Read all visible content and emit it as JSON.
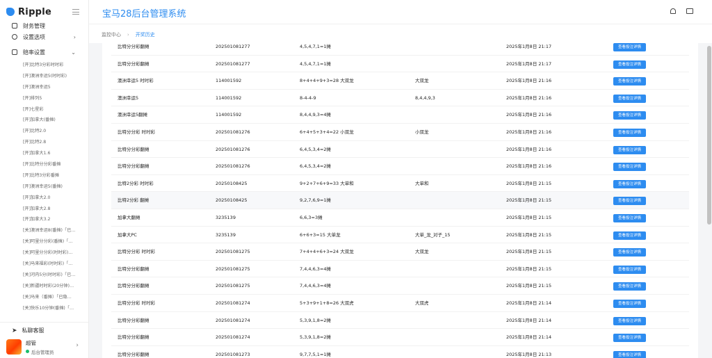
{
  "app": {
    "logo": "Ripple",
    "title": "宝马28后台管理系统"
  },
  "sidebar": {
    "partial_item": "财务管理",
    "settings": "设置选项",
    "lottery": "赔率设置",
    "items": [
      "[开]比特3分彩时时彩",
      "[开]澳洲幸运5(时时彩)",
      "[开]澳洲幸运5",
      "[开]排列5",
      "[开]七星彩",
      "[开]加拿大(番摊)",
      "[开]比特2.0",
      "[开]比特2.8",
      "[开]加拿大1.6",
      "[开]比特分分彩番摊",
      "[开]比特3分彩番摊",
      "[开]澳洲幸运5(番摊)",
      "[开]加拿大2.0",
      "[开]加拿大2.8",
      "[开]加拿大3.2",
      "[关]澳洲幸运8(番摊)「已…",
      "[关]阿里分分彩(番摊)「…",
      "[关]阿里分分彩(时时彩)…",
      "[关]马来福彩(时时彩)「…",
      "[关]河内5分(时时彩)「已…",
      "[关]新疆时时彩(20分钟)…",
      "[关]马来（番摊）「已隐…",
      "[关]快乐10分钟(番摊)「…"
    ],
    "service": "私聊客服",
    "user": {
      "name": "超管",
      "role": "后台管理员"
    }
  },
  "breadcrumb": {
    "home": "监控中心",
    "current": "开奖历史"
  },
  "table": {
    "button_label": "查看投注详情",
    "rows": [
      {
        "game": "比特分分彩翻摊",
        "issue": "202501081277",
        "result": "4,5,4,7,1=1摊",
        "extra": "",
        "time": "2025年1月8日 21:17"
      },
      {
        "game": "比特分分彩翻摊",
        "issue": "202501081277",
        "result": "4,5,4,7,1=1摊",
        "extra": "",
        "time": "2025年1月8日 21:17"
      },
      {
        "game": "澳洲幸运5 时时彩",
        "issue": "114001592",
        "result": "8+4+4+9+3=28 大双龙",
        "extra": "大双龙",
        "time": "2025年1月8日 21:16"
      },
      {
        "game": "澳洲幸运5",
        "issue": "114001592",
        "result": "8-4-4-9",
        "extra": "8,4,4,9,3",
        "time": "2025年1月8日 21:16"
      },
      {
        "game": "澳洲幸运5翻摊",
        "issue": "114001592",
        "result": "8,4,4,9,3=4摊",
        "extra": "",
        "time": "2025年1月8日 21:16"
      },
      {
        "game": "比特分分彩 时时彩",
        "issue": "202501081276",
        "result": "6+4+5+3+4=22 小双龙",
        "extra": "小双龙",
        "time": "2025年1月8日 21:16"
      },
      {
        "game": "比特分分彩翻摊",
        "issue": "202501081276",
        "result": "6,4,5,3,4=2摊",
        "extra": "",
        "time": "2025年1月8日 21:16"
      },
      {
        "game": "比特分分彩翻摊",
        "issue": "202501081276",
        "result": "6,4,5,3,4=2摊",
        "extra": "",
        "time": "2025年1月8日 21:16"
      },
      {
        "game": "比特2分彩 时时彩",
        "issue": "20250108425",
        "result": "9+2+7+6+9=33 大单和",
        "extra": "大单和",
        "time": "2025年1月8日 21:15"
      },
      {
        "game": "比特2分彩 翻摊",
        "issue": "20250108425",
        "result": "9,2,7,6,9=1摊",
        "extra": "",
        "time": "2025年1月8日 21:15"
      },
      {
        "game": "加拿大翻摊",
        "issue": "3235139",
        "result": "6,6,3=3摊",
        "extra": "",
        "time": "2025年1月8日 21:15"
      },
      {
        "game": "加拿大PC",
        "issue": "3235139",
        "result": "6+6+3=15 大单龙",
        "extra": "大单_龙_对子_15",
        "time": "2025年1月8日 21:15"
      },
      {
        "game": "比特分分彩 时时彩",
        "issue": "202501081275",
        "result": "7+4+4+6+3=24 大双龙",
        "extra": "大双龙",
        "time": "2025年1月8日 21:15"
      },
      {
        "game": "比特分分彩翻摊",
        "issue": "202501081275",
        "result": "7,4,4,6,3=4摊",
        "extra": "",
        "time": "2025年1月8日 21:15"
      },
      {
        "game": "比特分分彩翻摊",
        "issue": "202501081275",
        "result": "7,4,4,6,3=4摊",
        "extra": "",
        "time": "2025年1月8日 21:15"
      },
      {
        "game": "比特分分彩 时时彩",
        "issue": "202501081274",
        "result": "5+3+9+1+8=26 大双虎",
        "extra": "大双虎",
        "time": "2025年1月8日 21:14"
      },
      {
        "game": "比特分分彩翻摊",
        "issue": "202501081274",
        "result": "5,3,9,1,8=2摊",
        "extra": "",
        "time": "2025年1月8日 21:14"
      },
      {
        "game": "比特分分彩翻摊",
        "issue": "202501081274",
        "result": "5,3,9,1,8=2摊",
        "extra": "",
        "time": "2025年1月8日 21:14"
      },
      {
        "game": "比特分分彩翻摊",
        "issue": "202501081273",
        "result": "9,7,7,5,1=1摊",
        "extra": "",
        "time": "2025年1月8日 21:13"
      }
    ]
  }
}
